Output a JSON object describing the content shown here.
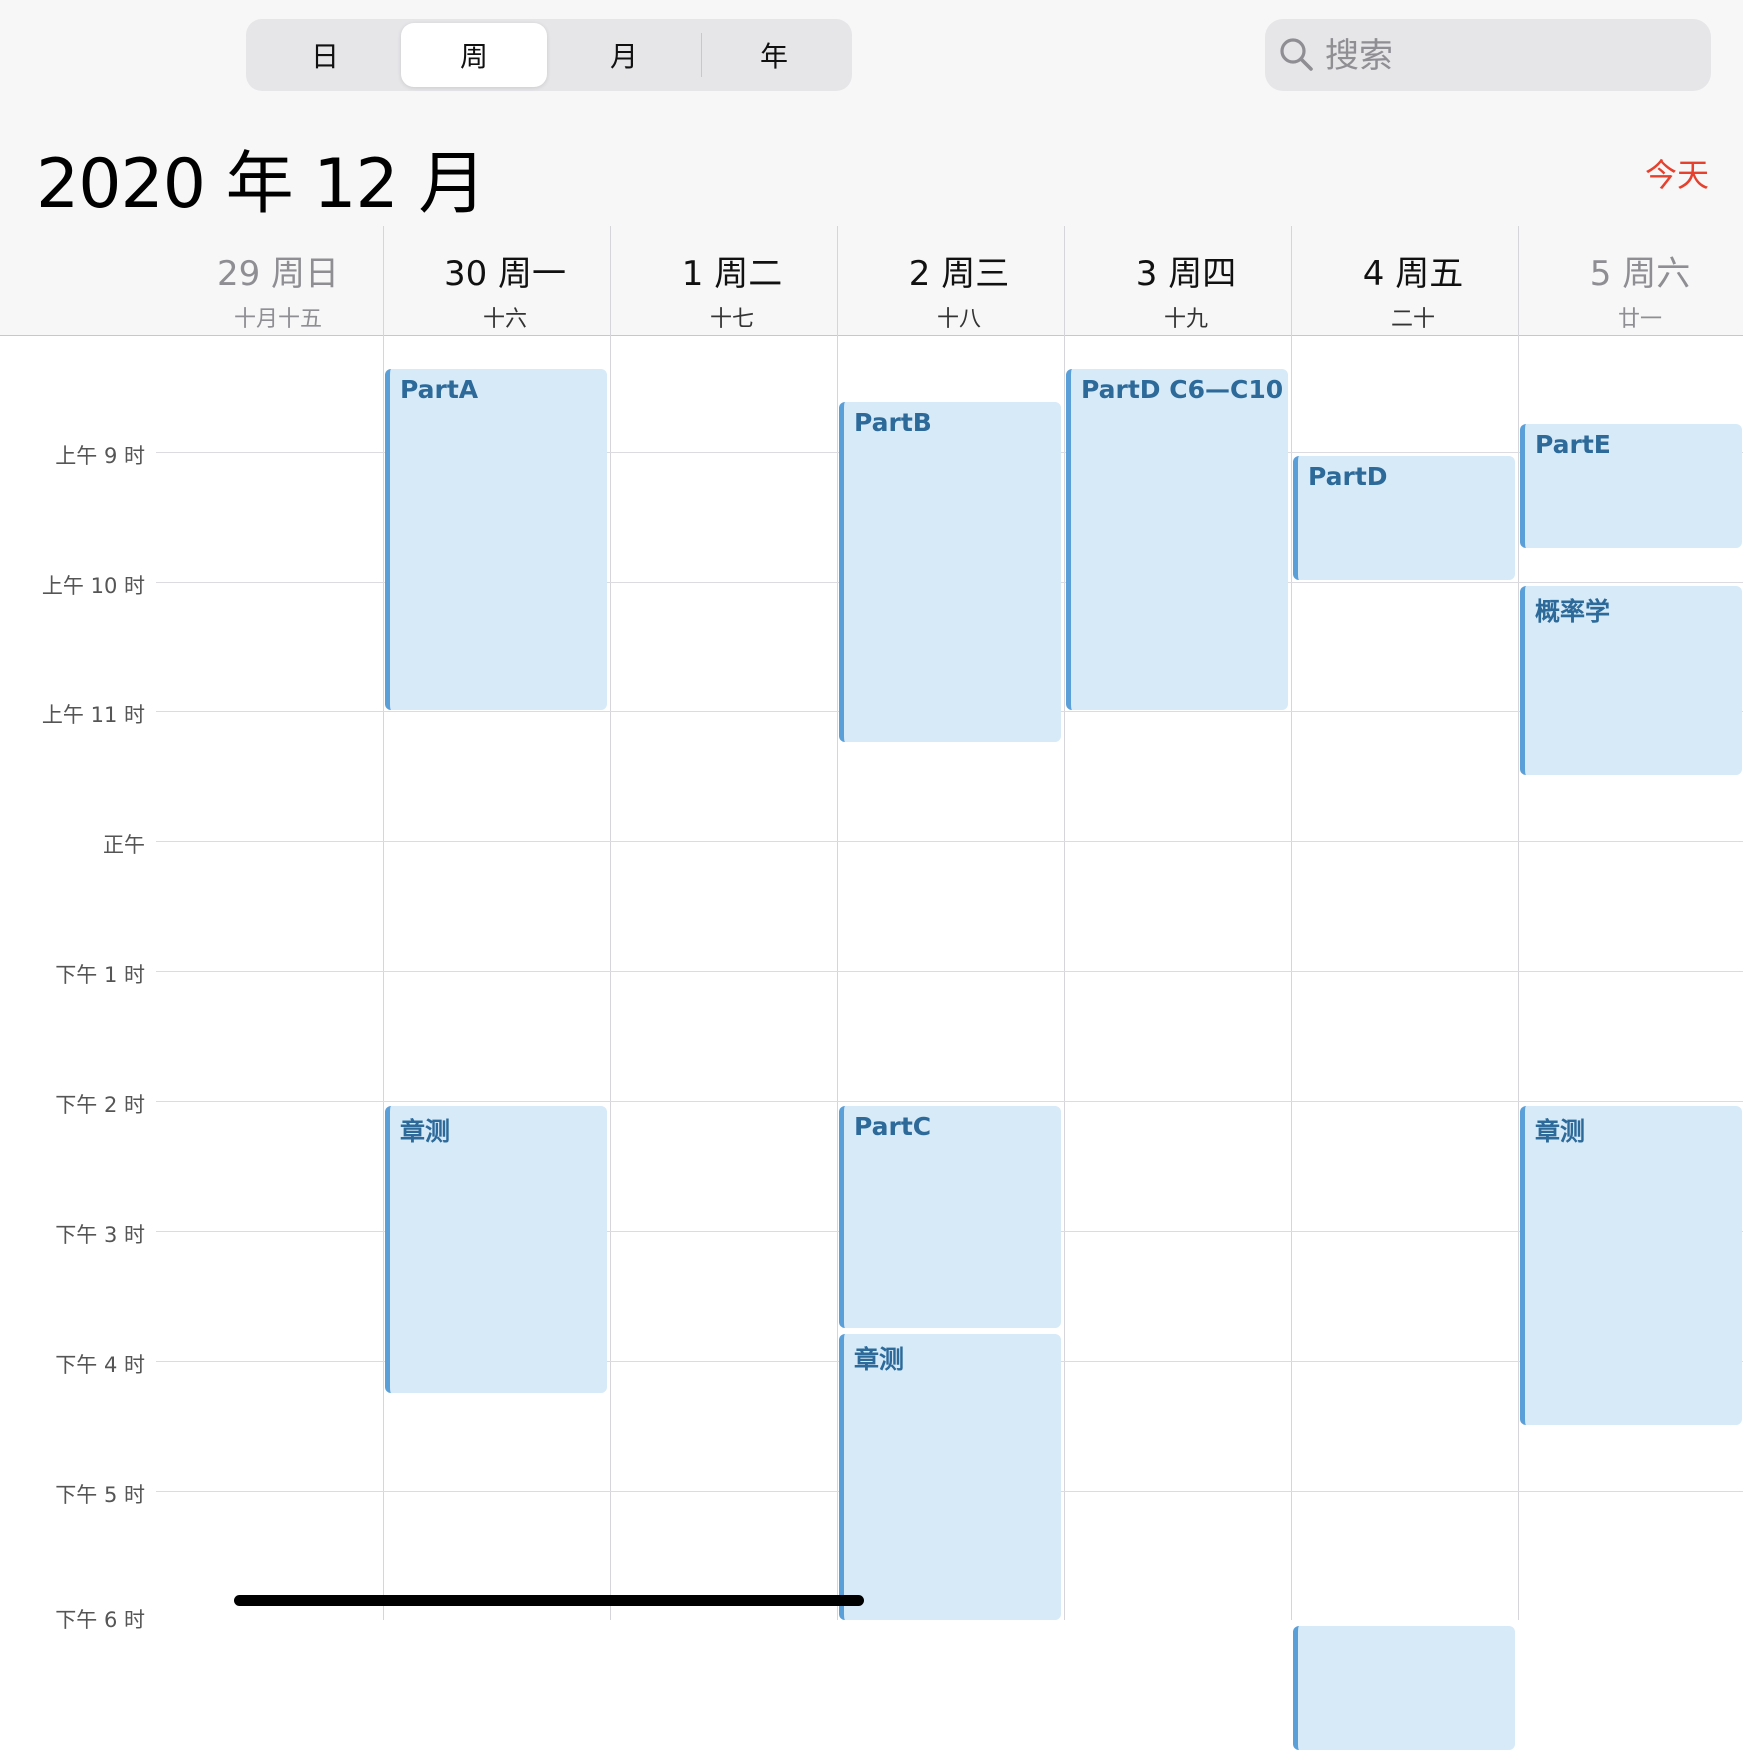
{
  "view_switcher": {
    "tabs": [
      "日",
      "周",
      "月",
      "年"
    ],
    "selected": "周"
  },
  "search": {
    "placeholder": "搜索"
  },
  "header": {
    "title": "2020 年 12 月",
    "today_label": "今天"
  },
  "days": [
    {
      "date": "29 周日",
      "lunar": "十月十五",
      "weekend": true
    },
    {
      "date": "30 周一",
      "lunar": "十六",
      "weekend": false
    },
    {
      "date": "1 周二",
      "lunar": "十七",
      "weekend": false
    },
    {
      "date": "2 周三",
      "lunar": "十八",
      "weekend": false
    },
    {
      "date": "3 周四",
      "lunar": "十九",
      "weekend": false
    },
    {
      "date": "4 周五",
      "lunar": "二十",
      "weekend": false
    },
    {
      "date": "5 周六",
      "lunar": "廿一",
      "weekend": true
    }
  ],
  "time_labels": [
    "上午 9 时",
    "上午 10 时",
    "上午 11 时",
    "正午",
    "下午 1 时",
    "下午 2 时",
    "下午 3 时",
    "下午 4 时",
    "下午 5 时",
    "下午 6 时"
  ],
  "events": [
    {
      "title": "PartA",
      "day": 1,
      "start": "08:20",
      "end": "11:00"
    },
    {
      "title": "PartB",
      "day": 3,
      "start": "08:35",
      "end": "11:15"
    },
    {
      "title": "PartD C6—C10",
      "day": 4,
      "start": "08:20",
      "end": "11:00"
    },
    {
      "title": "PartD",
      "day": 5,
      "start": "09:00",
      "end": "10:00"
    },
    {
      "title": "PartE",
      "day": 6,
      "start": "08:45",
      "end": "09:45"
    },
    {
      "title": "概率学",
      "day": 6,
      "start": "10:00",
      "end": "11:30"
    },
    {
      "title": "章测",
      "day": 1,
      "start": "14:00",
      "end": "16:15"
    },
    {
      "title": "PartC",
      "day": 3,
      "start": "14:00",
      "end": "15:45"
    },
    {
      "title": "章测",
      "day": 3,
      "start": "15:45",
      "end": "18:00"
    },
    {
      "title": "章测",
      "day": 6,
      "start": "14:00",
      "end": "16:30"
    },
    {
      "title": "",
      "day": 5,
      "start": "18:00",
      "end": "19:00"
    }
  ],
  "colors": {
    "accent_red": "#e5412e",
    "event_fill": "#d6eaf8",
    "event_bar": "#5b9fd8",
    "event_text": "#2d6a9a"
  }
}
